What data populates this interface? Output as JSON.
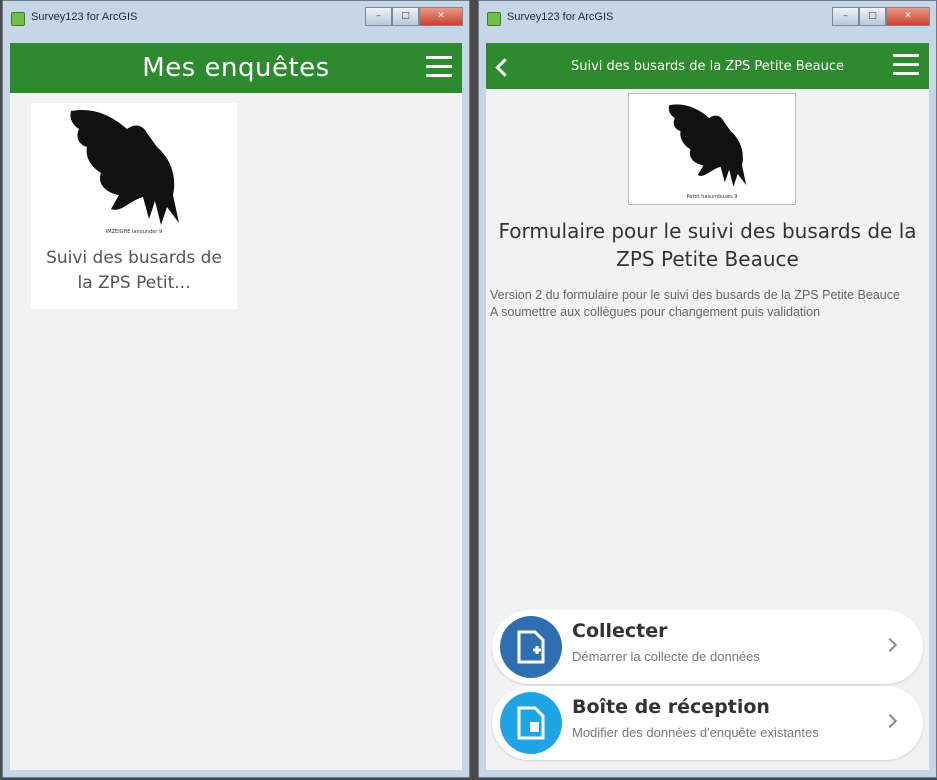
{
  "colors": {
    "appbar": "#2d8a2e",
    "collect": "#2f6fb0",
    "inbox": "#1fa5e6"
  },
  "window1": {
    "title": "Survey123 for ArcGIS",
    "header": "Mes enquêtes",
    "card": {
      "image_caption": "IMZEIGHE lanounder 9",
      "title": "Suivi des busards de la ZPS Petit..."
    }
  },
  "window2": {
    "title": "Survey123 for ArcGIS",
    "header": "Suivi des busards de la ZPS Petite Beauce",
    "image_caption": "Pattit hasumbuses 9",
    "survey_title": "Formulaire pour le suivi des busards de la ZPS Petite Beauce",
    "description": "Version 2 du formulaire pour le suivi des busards de la ZPS Petite Beauce\nA soumettre aux collègues pour changement puis validation",
    "actions": [
      {
        "title": "Collecter",
        "subtitle": "Démarrer la collecte de données",
        "icon": "add-document-icon"
      },
      {
        "title": "Boîte de réception",
        "subtitle": "Modifier des données d'enquête existantes",
        "icon": "inbox-document-icon"
      }
    ]
  }
}
